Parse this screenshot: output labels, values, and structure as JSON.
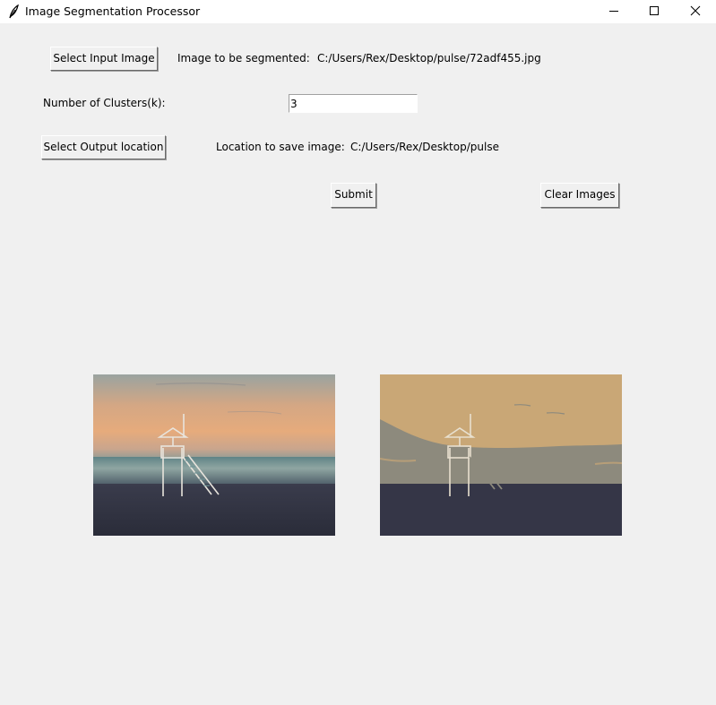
{
  "window": {
    "title": "Image Segmentation Processor",
    "icon": "feather-icon",
    "controls": [
      "minimize-icon",
      "maximize-icon",
      "close-icon"
    ]
  },
  "input": {
    "button_label": "Select Input Image",
    "caption": "Image to be segmented:",
    "path": "C:/Users/Rex/Desktop/pulse/72adf455.jpg"
  },
  "clusters": {
    "label": "Number of Clusters(k):",
    "value": "3"
  },
  "output": {
    "button_label": "Select Output location",
    "caption": "Location to save image:",
    "path": "C:/Users/Rex/Desktop/pulse"
  },
  "actions": {
    "submit_label": "Submit",
    "clear_label": "Clear Images"
  },
  "images": {
    "original": "beach lifeguard tower photo",
    "segmented": "segmented beach lifeguard tower, 3 color clusters"
  },
  "colors": {
    "window_bg": "#f0f0f0",
    "sky_top": "#9aa3a0",
    "sky_sunset": "#e2a878",
    "sea": "#5f7f82",
    "sand": "#2c2e3c",
    "cluster_1": "#c9a776",
    "cluster_2": "#8d8a7d",
    "cluster_3": "#353647"
  }
}
